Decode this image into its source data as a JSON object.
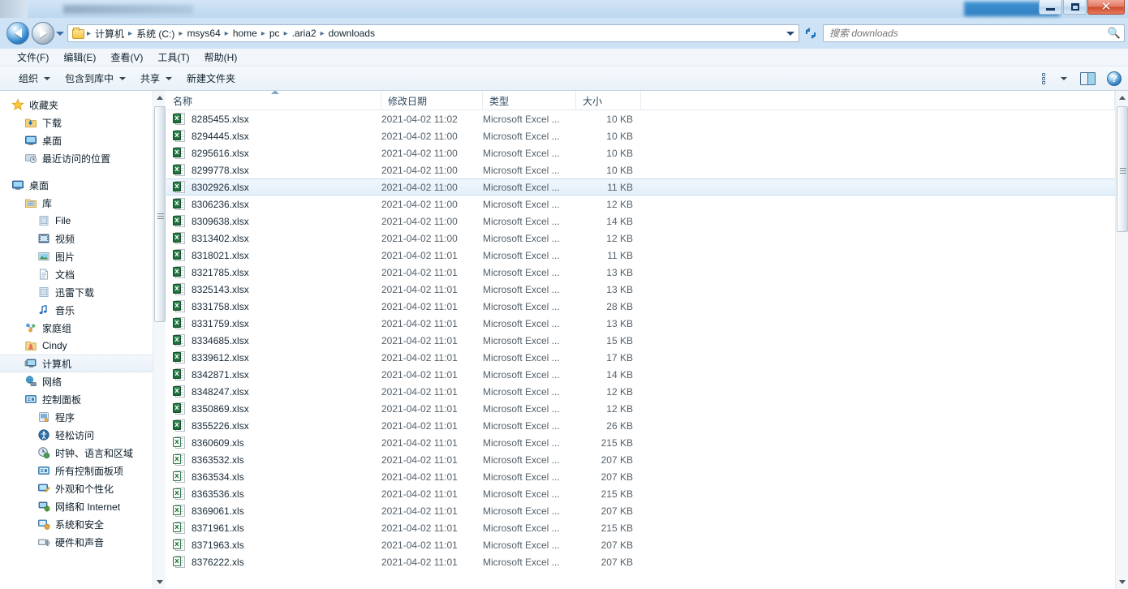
{
  "window": {
    "title": "",
    "title_redacted": true,
    "buttons": {
      "minimize": "最小化",
      "maximize": "最大化",
      "close": "关闭"
    }
  },
  "nav": {
    "back_label": "后退",
    "forward_label": "前进",
    "recent_dropdown_label": "最近浏览的位置",
    "refresh_label": "刷新",
    "breadcrumbs": [
      "计算机",
      "系统 (C:)",
      "msys64",
      "home",
      "pc",
      ".aria2",
      "downloads"
    ],
    "breadcrumb_separator": "▸"
  },
  "search": {
    "placeholder": "搜索 downloads",
    "value": "",
    "icon": "search-icon"
  },
  "menubar": {
    "items": [
      "文件(F)",
      "编辑(E)",
      "查看(V)",
      "工具(T)",
      "帮助(H)"
    ]
  },
  "toolbar": {
    "items": [
      {
        "label": "组织",
        "has_caret": true
      },
      {
        "label": "包含到库中",
        "has_caret": true
      },
      {
        "label": "共享",
        "has_caret": true
      },
      {
        "label": "新建文件夹",
        "has_caret": false
      }
    ],
    "right_icons": [
      "view-options-icon",
      "view-options-caret",
      "preview-pane-icon",
      "help-icon"
    ]
  },
  "sidebar": {
    "groups": [
      {
        "items": [
          {
            "label": "收藏夹",
            "icon": "star-icon",
            "indent": 0
          },
          {
            "label": "下载",
            "icon": "downloads-folder-icon",
            "indent": 1
          },
          {
            "label": "桌面",
            "icon": "desktop-icon",
            "indent": 1
          },
          {
            "label": "最近访问的位置",
            "icon": "recent-places-icon",
            "indent": 1
          }
        ]
      },
      {
        "items": [
          {
            "label": "桌面",
            "icon": "desktop-icon",
            "indent": 0
          },
          {
            "label": "库",
            "icon": "library-icon",
            "indent": 1
          },
          {
            "label": "File",
            "icon": "library-file-icon",
            "indent": 2
          },
          {
            "label": "视频",
            "icon": "video-icon",
            "indent": 2
          },
          {
            "label": "图片",
            "icon": "picture-icon",
            "indent": 2
          },
          {
            "label": "文档",
            "icon": "document-icon",
            "indent": 2
          },
          {
            "label": "迅雷下载",
            "icon": "library-file-icon",
            "indent": 2
          },
          {
            "label": "音乐",
            "icon": "music-icon",
            "indent": 2
          },
          {
            "label": "家庭组",
            "icon": "homegroup-icon",
            "indent": 1
          },
          {
            "label": "Cindy",
            "icon": "user-folder-icon",
            "indent": 1
          },
          {
            "label": "计算机",
            "icon": "computer-icon",
            "indent": 1,
            "selected": true
          },
          {
            "label": "网络",
            "icon": "network-icon",
            "indent": 1
          },
          {
            "label": "控制面板",
            "icon": "control-panel-icon",
            "indent": 1
          },
          {
            "label": "程序",
            "icon": "programs-icon",
            "indent": 2
          },
          {
            "label": "轻松访问",
            "icon": "ease-of-access-icon",
            "indent": 2
          },
          {
            "label": "时钟、语言和区域",
            "icon": "clock-region-icon",
            "indent": 2
          },
          {
            "label": "所有控制面板项",
            "icon": "all-control-panel-icon",
            "indent": 2
          },
          {
            "label": "外观和个性化",
            "icon": "appearance-icon",
            "indent": 2
          },
          {
            "label": "网络和 Internet",
            "icon": "network-internet-icon",
            "indent": 2
          },
          {
            "label": "系统和安全",
            "icon": "system-security-icon",
            "indent": 2
          },
          {
            "label": "硬件和声音",
            "icon": "hardware-sound-icon",
            "indent": 2
          }
        ]
      }
    ]
  },
  "filelist": {
    "columns": [
      {
        "key": "name",
        "label": "名称",
        "sorted": "asc"
      },
      {
        "key": "date",
        "label": "修改日期",
        "sorted": null
      },
      {
        "key": "type",
        "label": "类型",
        "sorted": null
      },
      {
        "key": "size",
        "label": "大小",
        "sorted": null
      }
    ],
    "rows": [
      {
        "name": "8285455.xlsx",
        "date": "2021-04-02 11:02",
        "type": "Microsoft Excel ...",
        "size": "10 KB",
        "icon": "excel-xlsx-icon",
        "selected": false
      },
      {
        "name": "8294445.xlsx",
        "date": "2021-04-02 11:00",
        "type": "Microsoft Excel ...",
        "size": "10 KB",
        "icon": "excel-xlsx-icon",
        "selected": false
      },
      {
        "name": "8295616.xlsx",
        "date": "2021-04-02 11:00",
        "type": "Microsoft Excel ...",
        "size": "10 KB",
        "icon": "excel-xlsx-icon",
        "selected": false
      },
      {
        "name": "8299778.xlsx",
        "date": "2021-04-02 11:00",
        "type": "Microsoft Excel ...",
        "size": "10 KB",
        "icon": "excel-xlsx-icon",
        "selected": false
      },
      {
        "name": "8302926.xlsx",
        "date": "2021-04-02 11:00",
        "type": "Microsoft Excel ...",
        "size": "11 KB",
        "icon": "excel-xlsx-icon",
        "selected": true
      },
      {
        "name": "8306236.xlsx",
        "date": "2021-04-02 11:00",
        "type": "Microsoft Excel ...",
        "size": "12 KB",
        "icon": "excel-xlsx-icon",
        "selected": false
      },
      {
        "name": "8309638.xlsx",
        "date": "2021-04-02 11:00",
        "type": "Microsoft Excel ...",
        "size": "14 KB",
        "icon": "excel-xlsx-icon",
        "selected": false
      },
      {
        "name": "8313402.xlsx",
        "date": "2021-04-02 11:00",
        "type": "Microsoft Excel ...",
        "size": "12 KB",
        "icon": "excel-xlsx-icon",
        "selected": false
      },
      {
        "name": "8318021.xlsx",
        "date": "2021-04-02 11:01",
        "type": "Microsoft Excel ...",
        "size": "11 KB",
        "icon": "excel-xlsx-icon",
        "selected": false
      },
      {
        "name": "8321785.xlsx",
        "date": "2021-04-02 11:01",
        "type": "Microsoft Excel ...",
        "size": "13 KB",
        "icon": "excel-xlsx-icon",
        "selected": false
      },
      {
        "name": "8325143.xlsx",
        "date": "2021-04-02 11:01",
        "type": "Microsoft Excel ...",
        "size": "13 KB",
        "icon": "excel-xlsx-icon",
        "selected": false
      },
      {
        "name": "8331758.xlsx",
        "date": "2021-04-02 11:01",
        "type": "Microsoft Excel ...",
        "size": "28 KB",
        "icon": "excel-xlsx-icon",
        "selected": false
      },
      {
        "name": "8331759.xlsx",
        "date": "2021-04-02 11:01",
        "type": "Microsoft Excel ...",
        "size": "13 KB",
        "icon": "excel-xlsx-icon",
        "selected": false
      },
      {
        "name": "8334685.xlsx",
        "date": "2021-04-02 11:01",
        "type": "Microsoft Excel ...",
        "size": "15 KB",
        "icon": "excel-xlsx-icon",
        "selected": false
      },
      {
        "name": "8339612.xlsx",
        "date": "2021-04-02 11:01",
        "type": "Microsoft Excel ...",
        "size": "17 KB",
        "icon": "excel-xlsx-icon",
        "selected": false
      },
      {
        "name": "8342871.xlsx",
        "date": "2021-04-02 11:01",
        "type": "Microsoft Excel ...",
        "size": "14 KB",
        "icon": "excel-xlsx-icon",
        "selected": false
      },
      {
        "name": "8348247.xlsx",
        "date": "2021-04-02 11:01",
        "type": "Microsoft Excel ...",
        "size": "12 KB",
        "icon": "excel-xlsx-icon",
        "selected": false
      },
      {
        "name": "8350869.xlsx",
        "date": "2021-04-02 11:01",
        "type": "Microsoft Excel ...",
        "size": "12 KB",
        "icon": "excel-xlsx-icon",
        "selected": false
      },
      {
        "name": "8355226.xlsx",
        "date": "2021-04-02 11:01",
        "type": "Microsoft Excel ...",
        "size": "26 KB",
        "icon": "excel-xlsx-icon",
        "selected": false
      },
      {
        "name": "8360609.xls",
        "date": "2021-04-02 11:01",
        "type": "Microsoft Excel ...",
        "size": "215 KB",
        "icon": "excel-xls-icon",
        "selected": false
      },
      {
        "name": "8363532.xls",
        "date": "2021-04-02 11:01",
        "type": "Microsoft Excel ...",
        "size": "207 KB",
        "icon": "excel-xls-icon",
        "selected": false
      },
      {
        "name": "8363534.xls",
        "date": "2021-04-02 11:01",
        "type": "Microsoft Excel ...",
        "size": "207 KB",
        "icon": "excel-xls-icon",
        "selected": false
      },
      {
        "name": "8363536.xls",
        "date": "2021-04-02 11:01",
        "type": "Microsoft Excel ...",
        "size": "215 KB",
        "icon": "excel-xls-icon",
        "selected": false
      },
      {
        "name": "8369061.xls",
        "date": "2021-04-02 11:01",
        "type": "Microsoft Excel ...",
        "size": "207 KB",
        "icon": "excel-xls-icon",
        "selected": false
      },
      {
        "name": "8371961.xls",
        "date": "2021-04-02 11:01",
        "type": "Microsoft Excel ...",
        "size": "215 KB",
        "icon": "excel-xls-icon",
        "selected": false
      },
      {
        "name": "8371963.xls",
        "date": "2021-04-02 11:01",
        "type": "Microsoft Excel ...",
        "size": "207 KB",
        "icon": "excel-xls-icon",
        "selected": false
      },
      {
        "name": "8376222.xls",
        "date": "2021-04-02 11:01",
        "type": "Microsoft Excel ...",
        "size": "207 KB",
        "icon": "excel-xls-icon",
        "selected": false
      }
    ]
  },
  "colors": {
    "accent": "#3f92d2",
    "selection_bg": "#e3eff9",
    "selection_border": "#c3dbf0",
    "excel_green": "#1d6b3a",
    "close_red": "#cf4b2c",
    "header_text": "#2b485f"
  }
}
